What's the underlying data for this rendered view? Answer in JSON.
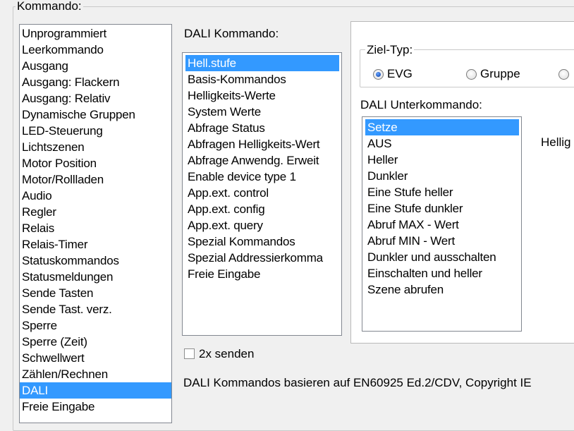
{
  "kommando": {
    "legend": "Kommando:",
    "items": [
      "Unprogrammiert",
      "Leerkommando",
      "Ausgang",
      "Ausgang: Flackern",
      "Ausgang: Relativ",
      "Dynamische Gruppen",
      "LED-Steuerung",
      "Lichtszenen",
      "Motor Position",
      "Motor/Rollladen",
      "Audio",
      "Regler",
      "Relais",
      "Relais-Timer",
      "Statuskommandos",
      "Statusmeldungen",
      "Sende Tasten",
      "Sende Tast. verz.",
      "Sperre",
      "Sperre (Zeit)",
      "Schwellwert",
      "Zählen/Rechnen",
      "DALI",
      "Freie Eingabe"
    ],
    "selected_index": 22
  },
  "dali": {
    "label": "DALI Kommando:",
    "items": [
      "Hell.stufe",
      "Basis-Kommandos",
      "Helligkeits-Werte",
      "System Werte",
      "Abfrage Status",
      "Abfragen Helligkeits-Wert",
      "Abfrage Anwendg. Erweit",
      "Enable device type 1",
      "App.ext. control",
      "App.ext. config",
      "App.ext. query",
      "Spezial Kommandos",
      "Spezial Addressierkomma",
      "Freie Eingabe"
    ],
    "selected_index": 0,
    "send_twice_label": "2x senden",
    "send_twice_checked": false,
    "footer_text": "DALI Kommandos basieren auf EN60925 Ed.2/CDV, Copyright IE"
  },
  "ziel_typ": {
    "legend": "Ziel-Typ:",
    "options": [
      "EVG",
      "Gruppe",
      ""
    ],
    "selected_index": 0
  },
  "unterkommando": {
    "label": "DALI Unterkommando:",
    "items": [
      "Setze",
      "AUS",
      "Heller",
      "Dunkler",
      "Eine Stufe heller",
      "Eine Stufe dunkler",
      "Abruf MAX - Wert",
      "Abruf MIN - Wert",
      "Dunkler und ausschalten",
      "Einschalten und heller",
      "Szene abrufen"
    ],
    "selected_index": 0
  },
  "helligkeit_label": "Hellig",
  "colors": {
    "selection": "#3399ff",
    "background": "#f0f0f0"
  }
}
